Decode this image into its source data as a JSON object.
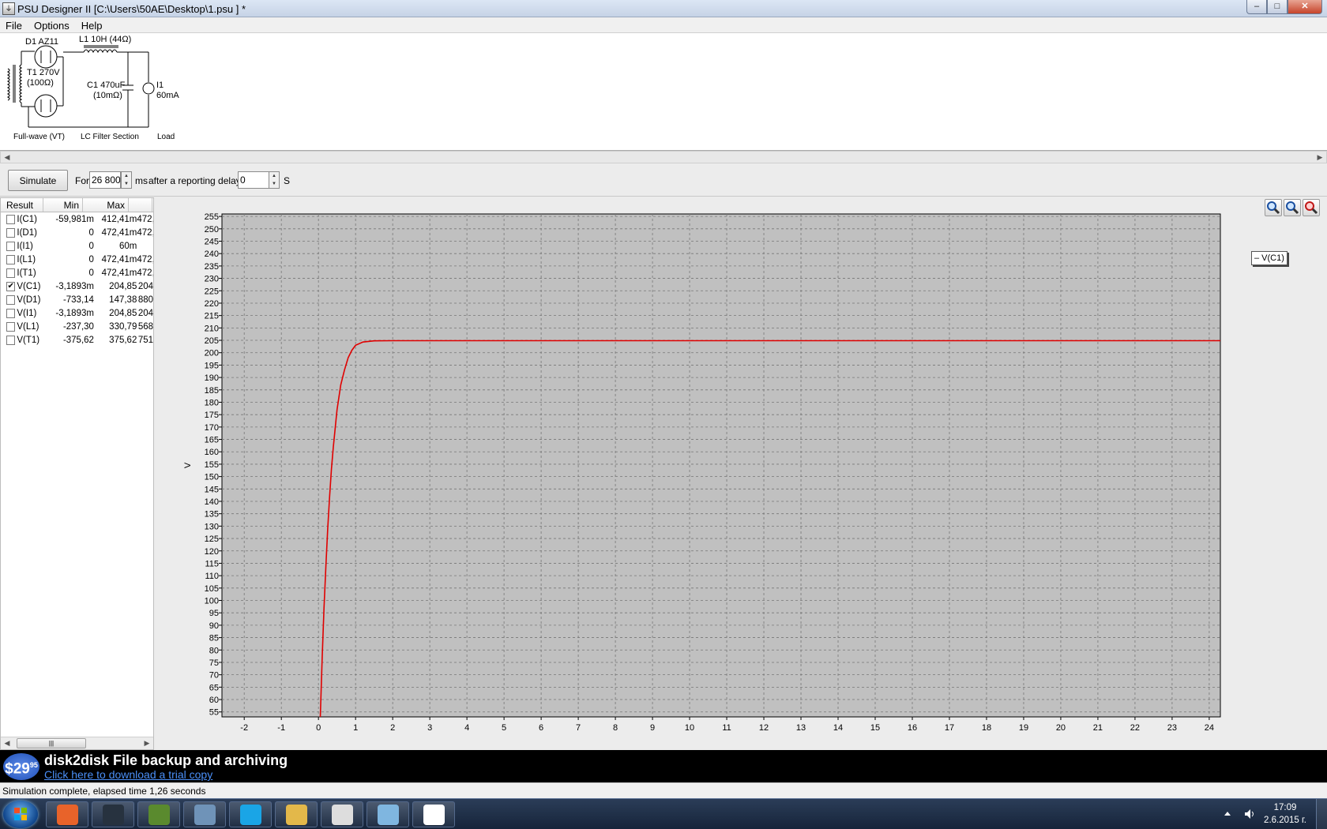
{
  "window": {
    "title": "PSU Designer II  [C:\\Users\\50AE\\Desktop\\1.psu ] *",
    "controls": {
      "minimize": "–",
      "maximize": "□",
      "close": "✕"
    }
  },
  "menu": {
    "items": [
      "File",
      "Options",
      "Help"
    ]
  },
  "schematic": {
    "d1": "D1 AZ11",
    "l1": "L1 10H (44Ω)",
    "t1_line1": "T1 270V",
    "t1_line2": "(100Ω)",
    "c1_line1": "C1 470uF",
    "c1_line2": "(10mΩ)",
    "i1_line1": "I1",
    "i1_line2": "60mA",
    "section_fullwave": "Full-wave (VT)",
    "section_lc": "LC Filter Section",
    "section_load": "Load"
  },
  "toolbar": {
    "simulate_label": "Simulate",
    "for_label": "For",
    "duration_value": "26 800",
    "ms_label": "ms",
    "delay_label": "after a reporting delay of",
    "delay_value": "0",
    "s_label": "S"
  },
  "results": {
    "headers": {
      "result": "Result",
      "min": "Min",
      "max": "Max"
    },
    "rows": [
      {
        "name": "I(C1)",
        "min": "-59,981m",
        "max": "412,41m",
        "extra": "472,",
        "checked": false
      },
      {
        "name": "I(D1)",
        "min": "0",
        "max": "472,41m",
        "extra": "472,",
        "checked": false
      },
      {
        "name": "I(I1)",
        "min": "0",
        "max": "60m",
        "extra": "",
        "checked": false
      },
      {
        "name": "I(L1)",
        "min": "0",
        "max": "472,41m",
        "extra": "472,",
        "checked": false
      },
      {
        "name": "I(T1)",
        "min": "0",
        "max": "472,41m",
        "extra": "472,",
        "checked": false
      },
      {
        "name": "V(C1)",
        "min": "-3,1893m",
        "max": "204,85",
        "extra": "204",
        "checked": true
      },
      {
        "name": "V(D1)",
        "min": "-733,14",
        "max": "147,38",
        "extra": "880",
        "checked": false
      },
      {
        "name": "V(I1)",
        "min": "-3,1893m",
        "max": "204,85",
        "extra": "204",
        "checked": false
      },
      {
        "name": "V(L1)",
        "min": "-237,30",
        "max": "330,79",
        "extra": "568",
        "checked": false
      },
      {
        "name": "V(T1)",
        "min": "-375,62",
        "max": "375,62",
        "extra": "751",
        "checked": false
      }
    ],
    "scroll_thumb": "|||"
  },
  "chart_data": {
    "type": "line",
    "title": "",
    "xlabel": "",
    "ylabel": "V",
    "xlim": [
      -2.6,
      24.3
    ],
    "ylim": [
      53,
      256
    ],
    "x_ticks": [
      -2,
      -1,
      0,
      1,
      2,
      3,
      4,
      5,
      6,
      7,
      8,
      9,
      10,
      11,
      12,
      13,
      14,
      15,
      16,
      17,
      18,
      19,
      20,
      21,
      22,
      23,
      24
    ],
    "y_ticks": [
      55,
      60,
      65,
      70,
      75,
      80,
      85,
      90,
      95,
      100,
      105,
      110,
      115,
      120,
      125,
      130,
      135,
      140,
      145,
      150,
      155,
      160,
      165,
      170,
      175,
      180,
      185,
      190,
      195,
      200,
      205,
      210,
      215,
      220,
      225,
      230,
      235,
      240,
      245,
      250,
      255
    ],
    "grid": true,
    "legend": "top-right",
    "series": [
      {
        "name": "V(C1)",
        "color": "#e00000",
        "x": [
          0.05,
          0.1,
          0.15,
          0.2,
          0.25,
          0.3,
          0.35,
          0.4,
          0.5,
          0.6,
          0.7,
          0.8,
          0.9,
          1.0,
          1.2,
          1.5,
          2.0,
          5,
          10,
          15,
          20,
          24.3
        ],
        "y": [
          53,
          77,
          97,
          114,
          129,
          142,
          153,
          162,
          177,
          187,
          193,
          198,
          201,
          203,
          204.3,
          204.8,
          204.85,
          204.85,
          204.85,
          204.85,
          204.85,
          204.85
        ]
      }
    ]
  },
  "chart_legend": {
    "label": "– V(C1)"
  },
  "icons": [
    "zoom-in-icon",
    "zoom-out-icon",
    "zoom-reset-icon"
  ],
  "ad": {
    "price": "$29",
    "price_cents": "95",
    "title": "disk2disk File backup and archiving",
    "link": "Click here to download a trial copy"
  },
  "status": {
    "text": "Simulation complete, elapsed time 1,26 seconds"
  },
  "taskbar": {
    "apps": [
      "firefox",
      "steam",
      "minecraft",
      "calculator",
      "skype",
      "file-explorer",
      "panda",
      "app-blue",
      "psu-designer"
    ],
    "clock_time": "17:09",
    "clock_date": "2.6.2015 г."
  }
}
